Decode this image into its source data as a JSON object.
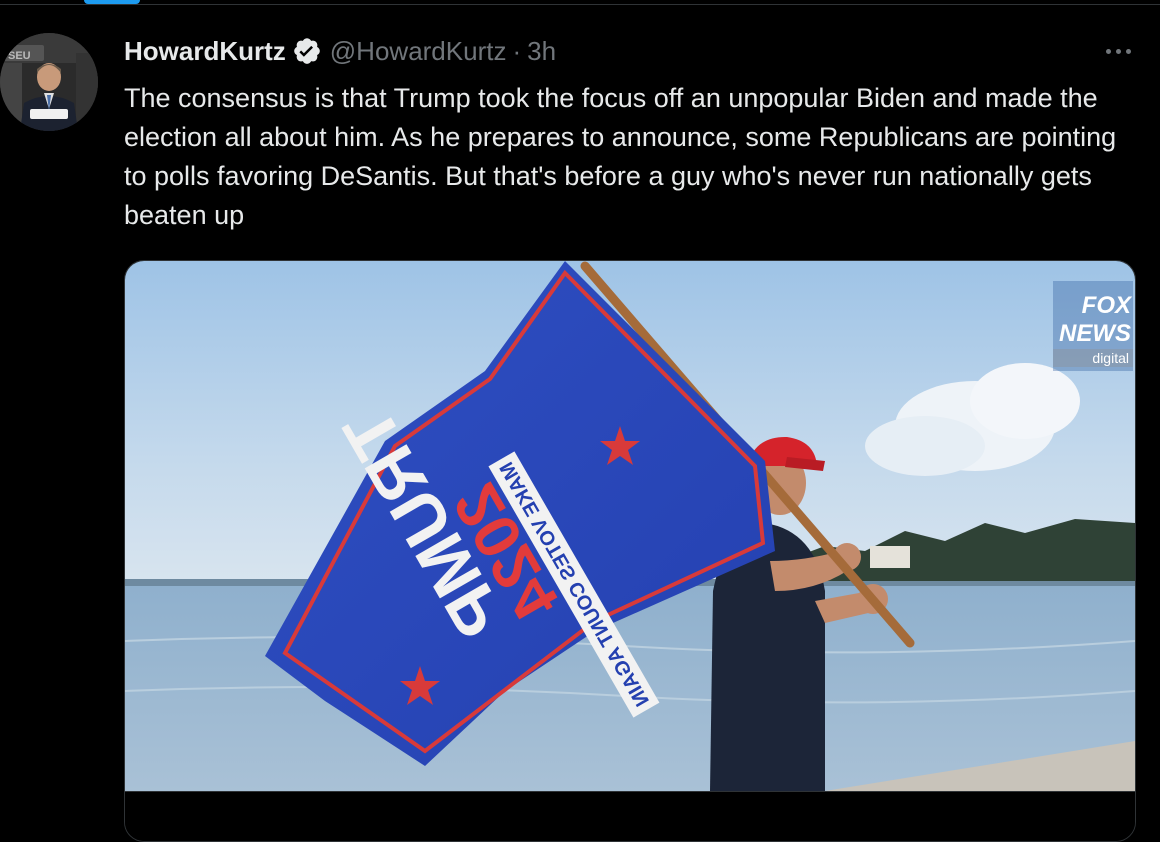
{
  "tweet": {
    "display_name": "HowardKurtz",
    "handle": "@HowardKurtz",
    "separator": "·",
    "time": "3h",
    "verified": true,
    "text": "The consensus is that Trump took the focus off an unpopular Biden and made the election all about him. As he prepares to announce, some Republicans are pointing to polls favoring DeSantis. But that's before a guy who's never run nationally gets beaten up",
    "more_icon": "ellipsis-icon",
    "verified_icon": "verified-badge-icon"
  },
  "media": {
    "watermark_line1": "FOX",
    "watermark_line2": "NEWS",
    "watermark_line3": "digital",
    "flag_text_main": "TRUMP",
    "flag_text_year": "2024",
    "flag_text_slogan": "MAKE VOTES COUNT AGAIN"
  },
  "colors": {
    "accent": "#1d9bf0",
    "text_primary": "#e7e9ea",
    "text_secondary": "#71767b",
    "border": "#2f3336",
    "background": "#000000"
  }
}
